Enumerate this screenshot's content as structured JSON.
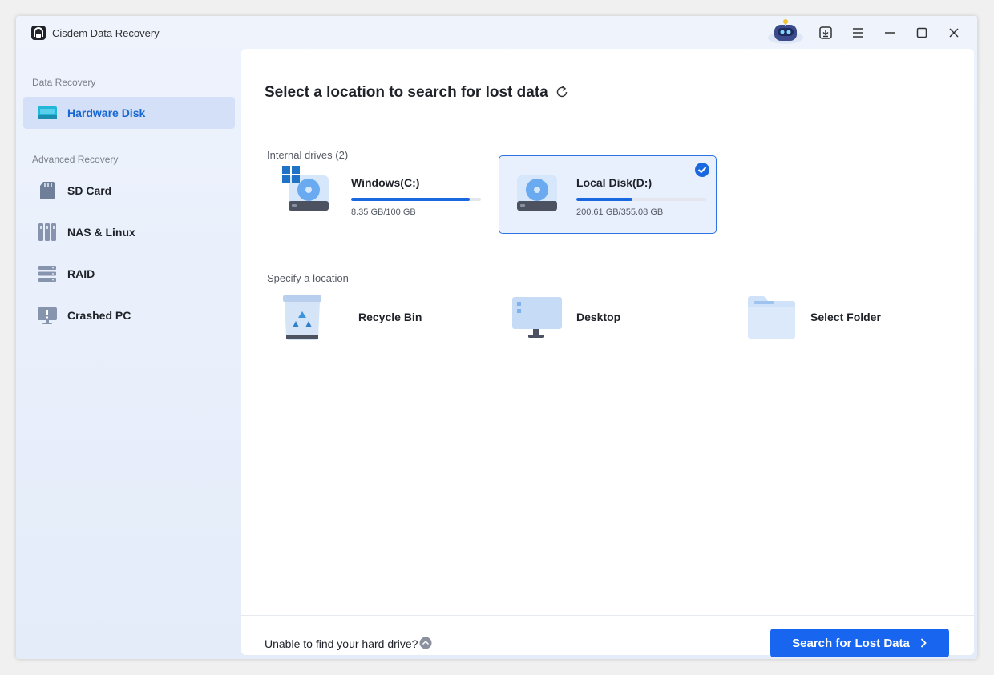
{
  "app": {
    "title": "Cisdem Data Recovery"
  },
  "sidebar": {
    "section_recovery": "Data Recovery",
    "section_advanced": "Advanced Recovery",
    "items": [
      {
        "label": "Hardware Disk",
        "icon": "hard-disk-icon",
        "active": true
      },
      {
        "label": "SD Card",
        "icon": "sd-card-icon"
      },
      {
        "label": "NAS & Linux",
        "icon": "nas-icon"
      },
      {
        "label": "RAID",
        "icon": "raid-icon"
      },
      {
        "label": "Crashed PC",
        "icon": "crashed-pc-icon"
      }
    ]
  },
  "main": {
    "heading": "Select a location to search for lost data",
    "internal_label": "Internal drives (2)",
    "drives": [
      {
        "name": "Windows(C:)",
        "size": "8.35 GB/100 GB",
        "usage_fraction": 0.914,
        "selected": false
      },
      {
        "name": "Local Disk(D:)",
        "size": "200.61 GB/355.08 GB",
        "usage_fraction": 0.435,
        "selected": true
      }
    ],
    "location_label": "Specify a location",
    "locations": [
      {
        "name": "Recycle Bin",
        "icon": "recycle-bin-icon"
      },
      {
        "name": "Desktop",
        "icon": "desktop-icon"
      },
      {
        "name": "Select Folder",
        "icon": "folder-icon"
      }
    ]
  },
  "footer": {
    "help_text": "Unable to find your hard drive?",
    "search_button": "Search for Lost Data"
  },
  "colors": {
    "accent": "#1865f0",
    "selected_bg": "#e9f0fd",
    "sidebar_active": "#d4e0f7"
  }
}
